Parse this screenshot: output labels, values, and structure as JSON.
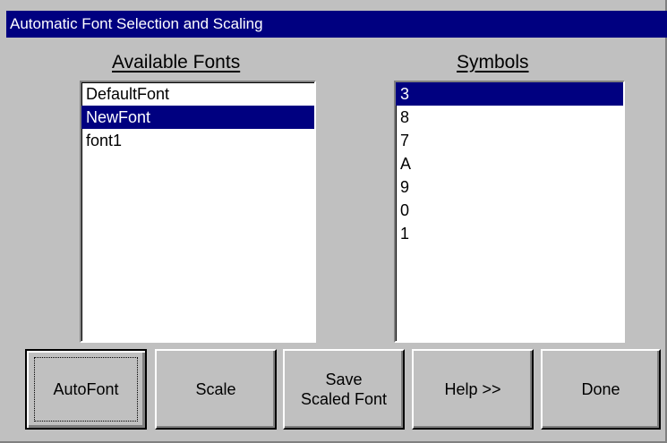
{
  "window": {
    "title": "Automatic Font Selection and Scaling"
  },
  "fonts_panel": {
    "heading": "Available Fonts",
    "items": [
      "DefaultFont",
      "NewFont",
      "font1"
    ],
    "selected": "NewFont"
  },
  "symbols_panel": {
    "heading": "Symbols",
    "items": [
      "3",
      "8",
      "7",
      "A",
      "9",
      "0",
      "1"
    ],
    "selected": "3"
  },
  "buttons": {
    "autofont": "AutoFont",
    "scale": "Scale",
    "save_scaled_font": "Save\nScaled Font",
    "help": "Help >>",
    "done": "Done"
  },
  "colors": {
    "title_bar": "#000080",
    "selection": "#000080",
    "face": "#c0c0c0"
  }
}
